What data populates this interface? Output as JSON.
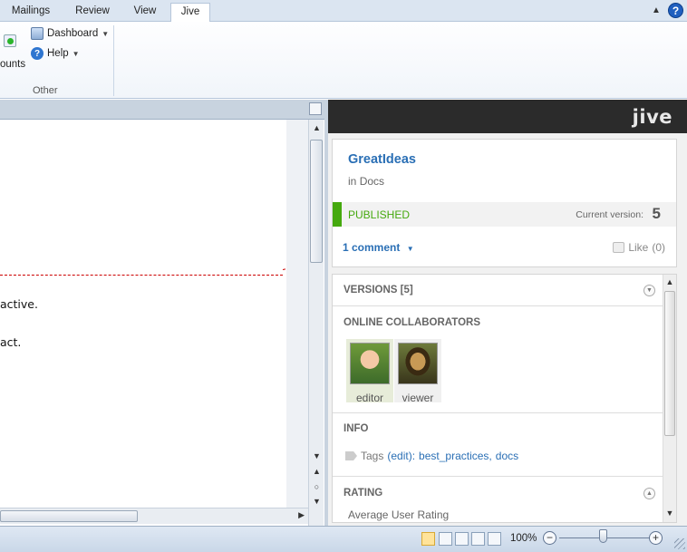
{
  "ribbon_tabs": [
    {
      "label": "Mailings"
    },
    {
      "label": "Review"
    },
    {
      "label": "View"
    },
    {
      "label": "Jive",
      "active": true
    }
  ],
  "ribbon": {
    "left_clipped_label": "ounts",
    "dashboard_label": "Dashboard",
    "help_label": "Help",
    "group_label": "Other",
    "help_glyph": "?"
  },
  "document": {
    "lines": [
      "active.",
      "act."
    ]
  },
  "jive": {
    "logo": "jive",
    "doc_title": "GreatIdeas",
    "in_prefix": "in",
    "in_place": "Docs",
    "status": "PUBLISHED",
    "current_version_label": "Current version:",
    "current_version": "5",
    "comments_label": "1 comment",
    "like_label": "Like",
    "like_count": "(0)",
    "versions_label": "VERSIONS [5]",
    "collaborators_label": "ONLINE COLLABORATORS",
    "collaborators": [
      {
        "role": "editor"
      },
      {
        "role": "viewer"
      }
    ],
    "info_label": "INFO",
    "tags_label": "Tags",
    "tags_edit": "(edit):",
    "tags": [
      "best_practices,",
      "docs"
    ],
    "rating_label": "RATING",
    "rating_sub": "Average User Rating",
    "accent_color": "#45a90e",
    "link_color": "#2a6fb5"
  },
  "statusbar": {
    "zoom": "100%",
    "zoom_minus": "−",
    "zoom_plus": "+"
  }
}
